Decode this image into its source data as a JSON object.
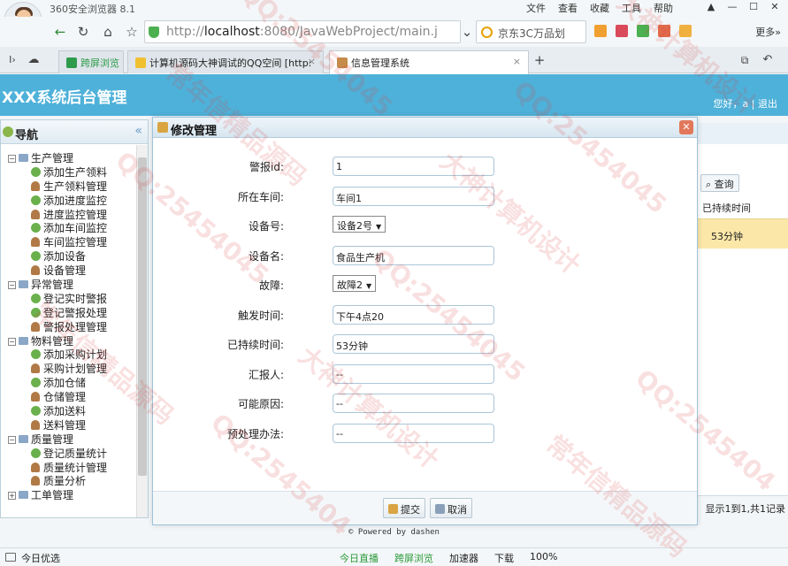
{
  "browser": {
    "name": "360安全浏览器 8.1",
    "menu": [
      "文件",
      "查看",
      "收藏",
      "工具",
      "帮助"
    ],
    "url_prefix": "http://",
    "url_host": "localhost",
    "url_rest": ":8080/JavaWebProject/main.j",
    "search_text": "京东3C万品划",
    "more_label": "更多»",
    "tabs": [
      {
        "label": "跨屏浏览"
      },
      {
        "label": "计算机源码大神调试的QQ空间 [http:"
      },
      {
        "label": "信息管理系统"
      }
    ],
    "colors": {
      "accent": "#4eb1d9",
      "selected": "#fbe7a8"
    }
  },
  "app": {
    "title": "XXX系统后台管理",
    "user_greeting": "您好，a",
    "logout_label": "退出",
    "powered_by": "© Powered by dashen"
  },
  "sidebar": {
    "header": "导航",
    "collapse_icon": "double-chevron-left-icon",
    "groups": [
      {
        "label": "生产管理",
        "items": [
          {
            "label": "添加生产领料",
            "icon": "plus-circle-icon"
          },
          {
            "label": "生产领料管理",
            "icon": "person-icon"
          },
          {
            "label": "添加进度监控",
            "icon": "plus-circle-icon"
          },
          {
            "label": "进度监控管理",
            "icon": "person-icon"
          },
          {
            "label": "添加车间监控",
            "icon": "plus-circle-icon"
          },
          {
            "label": "车间监控管理",
            "icon": "person-icon"
          },
          {
            "label": "添加设备",
            "icon": "plus-circle-icon"
          },
          {
            "label": "设备管理",
            "icon": "person-icon"
          }
        ]
      },
      {
        "label": "异常管理",
        "items": [
          {
            "label": "登记实时警报",
            "icon": "plus-circle-icon"
          },
          {
            "label": "实时警报管理",
            "icon": "person-icon",
            "selected": true
          },
          {
            "label": "登记警报处理",
            "icon": "plus-circle-icon"
          },
          {
            "label": "警报处理管理",
            "icon": "person-icon"
          }
        ]
      },
      {
        "label": "物料管理",
        "items": [
          {
            "label": "添加采购计划",
            "icon": "plus-circle-icon"
          },
          {
            "label": "采购计划管理",
            "icon": "person-icon"
          },
          {
            "label": "添加仓储",
            "icon": "plus-circle-icon"
          },
          {
            "label": "仓储管理",
            "icon": "person-icon"
          },
          {
            "label": "添加送料",
            "icon": "plus-circle-icon"
          },
          {
            "label": "送料管理",
            "icon": "person-icon"
          }
        ]
      },
      {
        "label": "质量管理",
        "items": [
          {
            "label": "登记质量统计",
            "icon": "plus-circle-icon"
          },
          {
            "label": "质量统计管理",
            "icon": "person-icon"
          },
          {
            "label": "质量分析",
            "icon": "person-icon"
          }
        ]
      },
      {
        "label": "工单管理",
        "items": []
      }
    ]
  },
  "background_grid": {
    "query_label": "查询",
    "column_header": "已持续时间",
    "selected_cell": "53分钟",
    "pager_text": "显示1到1,共1记录"
  },
  "dialog": {
    "title": "修改管理",
    "fields": [
      {
        "label": "警报id:",
        "value": "1",
        "type": "text"
      },
      {
        "label": "所在车间:",
        "value": "车间1",
        "type": "text"
      },
      {
        "label": "设备号:",
        "value": "设备2号",
        "type": "select"
      },
      {
        "label": "设备名:",
        "value": "食品生产机",
        "type": "text"
      },
      {
        "label": "故障:",
        "value": "故障2",
        "type": "select"
      },
      {
        "label": "触发时间:",
        "value": "下午4点20",
        "type": "text"
      },
      {
        "label": "已持续时间:",
        "value": "53分钟",
        "type": "text"
      },
      {
        "label": "汇报人:",
        "value": "--",
        "type": "text"
      },
      {
        "label": "可能原因:",
        "value": "--",
        "type": "text"
      },
      {
        "label": "预处理办法:",
        "value": "--",
        "type": "text"
      }
    ],
    "submit_label": "提交",
    "cancel_label": "取消"
  },
  "statusbar": {
    "left": "今日优选",
    "items": [
      "今日直播",
      "跨屏浏览",
      "加速器",
      "下载",
      "100%"
    ]
  },
  "watermark": {
    "texts": [
      "QQ:25454045",
      "大神计算机设计",
      "常年信精品源码",
      "QQ:2545404"
    ]
  }
}
